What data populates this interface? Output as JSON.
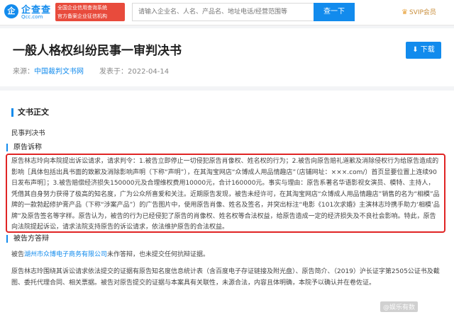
{
  "header": {
    "logo_mark": "企",
    "logo_text": "企查查",
    "logo_sub": "Qcc.com",
    "badge_line1": "全国企业信用查询系统",
    "badge_line2": "官方备案企业征信机构",
    "search_placeholder": "请输入企业名、人名、产品名、地址电话/经营范围等",
    "search_button": "查一下",
    "svip_label": "SVIP会员"
  },
  "doc": {
    "title": "一般人格权纠纷民事一审判决书",
    "source_label": "来源：",
    "source_link": "中国裁判文书网",
    "publish_label": "发表于：",
    "publish_date": "2022-04-14",
    "download_label": "下载"
  },
  "body": {
    "section_title": "文书正文",
    "doc_type": "民事判决书",
    "claims_heading": "原告诉称",
    "claims_text": "原告林志玲向本院提出诉讼请求，请求判令：1.被告立即停止一切侵犯原告肖像权、姓名权的行为；2.被告向原告赔礼道歉及消除侵权行为给原告造成的影响［具体包括出具书面的致歉及消除影响声明（下称“声明”），在其淘宝网店“众博成人用品情趣店”（店铺网址：×××.com/）首页显要位置上连续90日发布声明］；3.被告赔偿经济损失150000元及合理维权费用10000元，合计160000元。事实与理由：原告系著名华语影视女演员、模特、主持人，凭借其自身努力获得了极高的知名度，广为公众所喜爱和关注。近期原告发现，被告未经许可，在其淘宝网店“众博成人用品情趣店”销售的名为“相模”品牌的一款勃起修护膏产品（下称“涉案产品”）的广告图片中，使用原告肖像、姓名及签名，并突出标注“电影《101次求婚》主演林志玲携手助力‘相模’品牌”及原告签名等字样。原告认为，被告的行为已经侵犯了原告的肖像权、姓名权等合法权益，给原告造成一定的经济损失及不良社会影响。特此，原告向法院提起诉讼，请求法院支持原告的诉讼请求，依法维护原告的合法权益。",
    "defense_heading": "被告方答辩",
    "defense_prefix": "被告",
    "defense_link": "湖州市众博电子商务有限公司",
    "defense_suffix": "未作答辩，也未提交任何抗辩证据。",
    "evidence_text": "原告林志玲围绕其诉讼请求依法提交的证据有原告知名度信息统计表（含百度电子存证链接及附光盘）、原告简介、（2019）沪长证字第2505公证书及截图、委托代理合同、相关票据。被告对原告提交的证据与本案具有关联性，未源合法，内容且体明确，本院予以确认并在卷佐证。",
    "watermark": "@娱乐有数"
  }
}
